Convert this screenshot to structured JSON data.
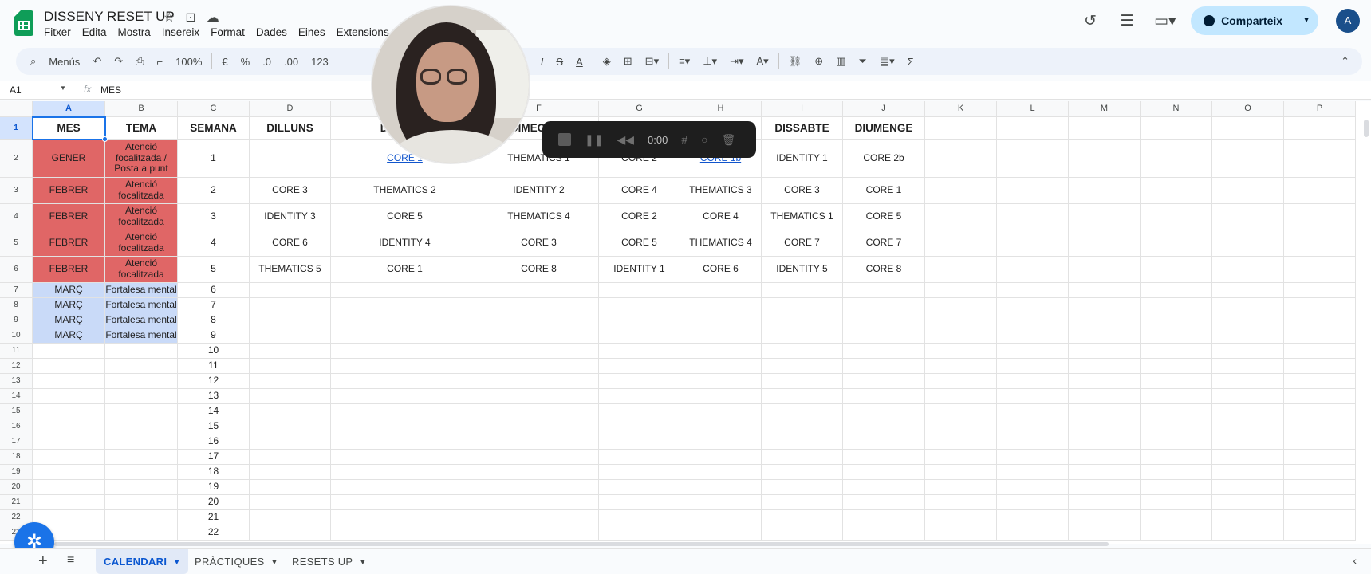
{
  "app": {
    "doc_title": "DISSENY RESET UP",
    "menus": [
      "Fitxer",
      "Edita",
      "Mostra",
      "Insereix",
      "Format",
      "Dades",
      "Eines",
      "Extensions"
    ],
    "share_label": "Comparteix",
    "avatar_initials": "A"
  },
  "toolbar": {
    "search_label": "Menús",
    "zoom": "100%",
    "currency": "€",
    "percent": "%",
    "dec_minus": ".0",
    "dec_plus": ".00",
    "number_format": "123"
  },
  "formula_bar": {
    "cell_ref": "A1",
    "fx": "fx",
    "value": "MES"
  },
  "sheet": {
    "columns": [
      "A",
      "B",
      "C",
      "D",
      "E",
      "F",
      "G",
      "H",
      "I",
      "J",
      "K",
      "L",
      "M",
      "N",
      "O",
      "P"
    ],
    "header_row": [
      "MES",
      "TEMA",
      "SEMANA",
      "DILLUNS",
      "DIMARTS",
      "DIMECRES",
      "DIJOUS",
      "DIVENDRES",
      "DISSABTE",
      "DIUMENGE"
    ],
    "rows": [
      [
        "GENER",
        "Atenció focalitzada / Posta a punt",
        "1",
        "",
        "CORE 1",
        "THEMATICS 1",
        "CORE 2",
        "CORE 1b",
        "IDENTITY 1",
        "CORE 2b"
      ],
      [
        "FEBRER",
        "Atenció focalitzada",
        "2",
        "CORE 3",
        "THEMATICS 2",
        "IDENTITY 2",
        "CORE 4",
        "THEMATICS 3",
        "CORE 3",
        "CORE 1"
      ],
      [
        "FEBRER",
        "Atenció focalitzada",
        "3",
        "IDENTITY 3",
        "CORE 5",
        "THEMATICS 4",
        "CORE 2",
        "CORE 4",
        "THEMATICS 1",
        "CORE 5"
      ],
      [
        "FEBRER",
        "Atenció focalitzada",
        "4",
        "CORE 6",
        "IDENTITY 4",
        "CORE 3",
        "CORE 5",
        "THEMATICS 4",
        "CORE 7",
        "CORE 7"
      ],
      [
        "FEBRER",
        "Atenció focalitzada",
        "5",
        "THEMATICS 5",
        "CORE 1",
        "CORE 8",
        "IDENTITY 1",
        "CORE 6",
        "IDENTITY 5",
        "CORE 8"
      ],
      [
        "MARÇ",
        "Fortalesa mental",
        "6"
      ],
      [
        "MARÇ",
        "Fortalesa mental",
        "7"
      ],
      [
        "MARÇ",
        "Fortalesa mental",
        "8"
      ],
      [
        "MARÇ",
        "Fortalesa mental",
        "9"
      ],
      [
        "",
        "",
        "10"
      ],
      [
        "",
        "",
        "11"
      ],
      [
        "",
        "",
        "12"
      ],
      [
        "",
        "",
        "13"
      ],
      [
        "",
        "",
        "14"
      ],
      [
        "",
        "",
        "15"
      ],
      [
        "",
        "",
        "16"
      ],
      [
        "",
        "",
        "17"
      ],
      [
        "",
        "",
        "18"
      ],
      [
        "",
        "",
        "19"
      ],
      [
        "",
        "",
        "20"
      ],
      [
        "",
        "",
        "21"
      ],
      [
        "",
        "",
        "22"
      ]
    ],
    "row_numbers": [
      "1",
      "2",
      "3",
      "4",
      "5",
      "6",
      "7",
      "8",
      "9",
      "10",
      "11",
      "12",
      "13",
      "14",
      "15",
      "16",
      "17",
      "18",
      "19",
      "20",
      "21",
      "22",
      "23"
    ]
  },
  "recorder": {
    "time": "0:00"
  },
  "tabs": [
    {
      "label": "CALENDARI",
      "active": true
    },
    {
      "label": "PRÀCTIQUES",
      "active": false
    },
    {
      "label": "RESETS UP",
      "active": false
    }
  ],
  "colors": {
    "red_cell": "#e06666",
    "blue_cell": "#c9daf8",
    "accent": "#1a73e8",
    "share_bg": "#c2e7ff"
  }
}
